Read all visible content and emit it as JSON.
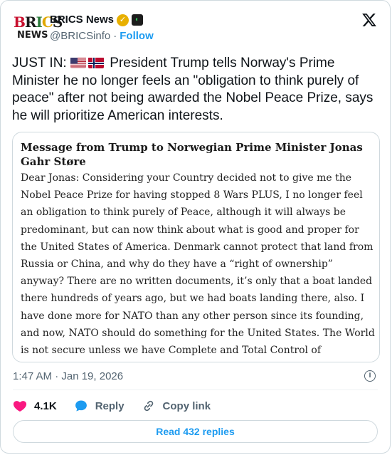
{
  "account": {
    "logo_line1": [
      "B",
      "R",
      "I",
      "C",
      "S"
    ],
    "logo_line2": "NEWS",
    "display_name": "BRICS News",
    "handle": "@BRICSinfo",
    "separator": "·",
    "follow_label": "Follow"
  },
  "tweet": {
    "prefix": "JUST IN:",
    "body": "President Trump tells Norway's Prime Minister he no longer feels an \"obligation to think purely of peace\" after not being awarded the Nobel Peace Prize, says he will prioritize American interests."
  },
  "media": {
    "title": "Message from Trump to Norwegian Prime Minister Jonas Gahr Støre",
    "body": "Dear Jonas: Considering your Country decided not to give me the Nobel Peace Prize for having stopped 8 Wars PLUS, I no longer feel an obligation to think purely of Peace, although it will always be predominant, but can now think about what is good and proper for the United States of America. Denmark cannot protect that land from Russia or China, and why do they have a “right of ownership” anyway? There are no written documents, it’s only that a boat landed there hundreds of years ago, but we had boats landing there, also. I have done more for NATO than any other person since its founding, and now, NATO should do something for the United States. The World is not secure unless we have Complete and Total Control of Greenland. Thank you! President DJT"
  },
  "meta": {
    "timestamp": "1:47 AM · Jan 19, 2026"
  },
  "actions": {
    "like_count": "4.1K",
    "reply_label": "Reply",
    "copy_label": "Copy link"
  },
  "read_replies_label": "Read 432 replies",
  "colors": {
    "accent": "#1d9bf0",
    "like": "#f91880",
    "muted": "#536471"
  }
}
